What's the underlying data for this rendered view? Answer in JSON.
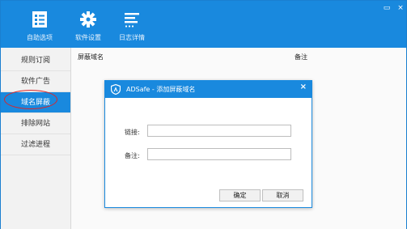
{
  "toolbar": {
    "items": [
      {
        "label": "自助选项",
        "icon": "list-icon"
      },
      {
        "label": "软件设置",
        "icon": "gear-icon"
      },
      {
        "label": "日志详情",
        "icon": "log-icon"
      }
    ]
  },
  "window_controls": {
    "minimize": "▭",
    "close": "×"
  },
  "sidebar": {
    "items": [
      {
        "label": "规则订阅"
      },
      {
        "label": "软件广告"
      },
      {
        "label": "域名屏蔽"
      },
      {
        "label": "排除网站"
      },
      {
        "label": "过滤进程"
      }
    ]
  },
  "table": {
    "headers": [
      "屏蔽域名",
      "备注"
    ]
  },
  "dialog": {
    "title": "ADSafe - 添加屏蔽域名",
    "close": "×",
    "link_label": "链接:",
    "note_label": "备注:",
    "link_value": "",
    "note_value": "",
    "ok_label": "确定",
    "cancel_label": "取消"
  },
  "colors": {
    "accent": "#1989de",
    "highlight_ellipse": "#d9262a"
  }
}
